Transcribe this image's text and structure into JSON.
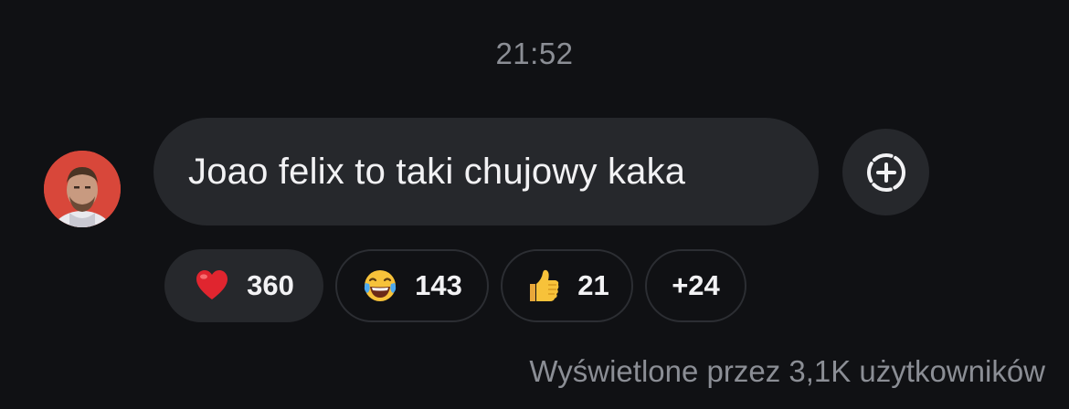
{
  "message": {
    "time": "21:52",
    "text": "Joao felix to taki chujowy kaka",
    "avatar_icon": "user-avatar",
    "add_reaction_icon": "add-reaction-icon"
  },
  "reactions": [
    {
      "emoji": "❤️",
      "icon": "heart-icon",
      "count": "360"
    },
    {
      "emoji": "😂",
      "icon": "laughing-tears-icon",
      "count": "143"
    },
    {
      "emoji": "👍",
      "icon": "thumbs-up-icon",
      "count": "21"
    },
    {
      "emoji": "",
      "icon": "",
      "count": "+24"
    }
  ],
  "seen_by": "Wyświetlone przez 3,1K użytkowników",
  "colors": {
    "background": "#101114",
    "bubble": "#26282c",
    "muted_text": "#8b8e95",
    "text": "#f2f2f4"
  }
}
